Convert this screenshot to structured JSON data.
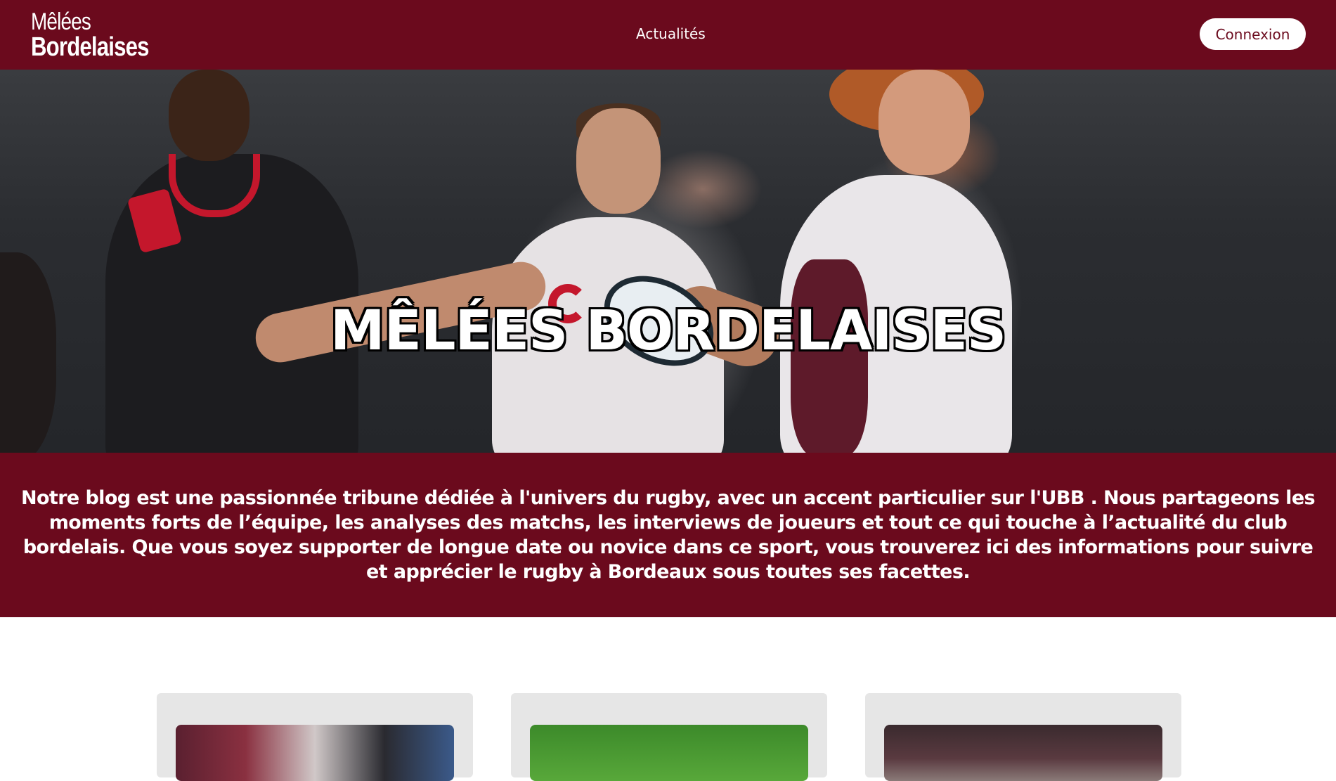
{
  "header": {
    "logo_top": "Mêlées",
    "logo_bottom": "Bordelaises",
    "nav_link": "Actualités",
    "login_label": "Connexion"
  },
  "hero": {
    "title": "MÊLÉES BORDELAISES"
  },
  "intro": {
    "text": "Notre blog est une passionnée tribune dédiée à l'univers du rugby, avec un accent particulier sur l'UBB . Nous partageons les moments forts de l’équipe, les analyses des matchs, les interviews de joueurs et tout ce qui touche à l’actualité du club bordelais. Que vous soyez supporter de longue date ou novice dans ce sport, vous trouverez ici des informations pour suivre et apprécier le rugby à Bordeaux sous toutes ses facettes."
  },
  "colors": {
    "brand": "#6b0a1d",
    "card_bg": "#e6e6e6",
    "text_light": "#ffffff"
  },
  "cards": [
    {
      "image": "rugby-match-photo"
    },
    {
      "image": "grass-pitch-photo"
    },
    {
      "image": "stadium-photo"
    }
  ]
}
